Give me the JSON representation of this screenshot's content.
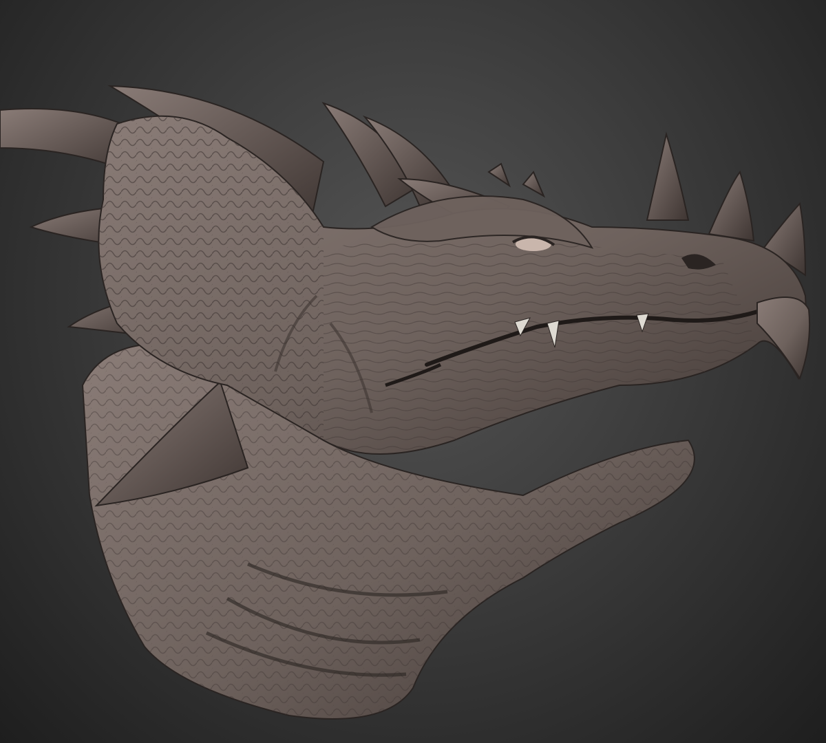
{
  "scene": {
    "subject": "dragon-head-sculpt",
    "colors": {
      "background_center": "#555555",
      "background_edge": "#1e1e1e",
      "clay_light": "#8a7c77",
      "clay_mid": "#6e625d",
      "clay_dark": "#3e3532",
      "clay_shadow": "#2a2422",
      "teeth": "#dedad2",
      "eye": "#c9b6ac"
    },
    "icons": []
  }
}
